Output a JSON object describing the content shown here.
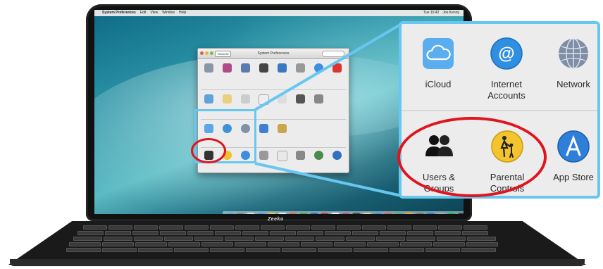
{
  "menubar": {
    "app": "System Preferences",
    "items": [
      "Edit",
      "View",
      "Window",
      "Help"
    ],
    "right": [
      "Tue 10:42",
      "Joe Kenny"
    ]
  },
  "syspref_window": {
    "title": "System Preferences",
    "show_all": "Show All"
  },
  "laptop": {
    "brand": "Zeeko"
  },
  "callout": {
    "icloud": "iCloud",
    "internet_accounts": [
      "Internet",
      "Accounts"
    ],
    "network": "Network",
    "users_groups": [
      "Users &",
      "Groups"
    ],
    "parental_controls": [
      "Parental",
      "Controls"
    ],
    "app_store": "App Store"
  },
  "colors": {
    "highlight_blue": "#67c7f0",
    "highlight_red": "#e0141e"
  }
}
